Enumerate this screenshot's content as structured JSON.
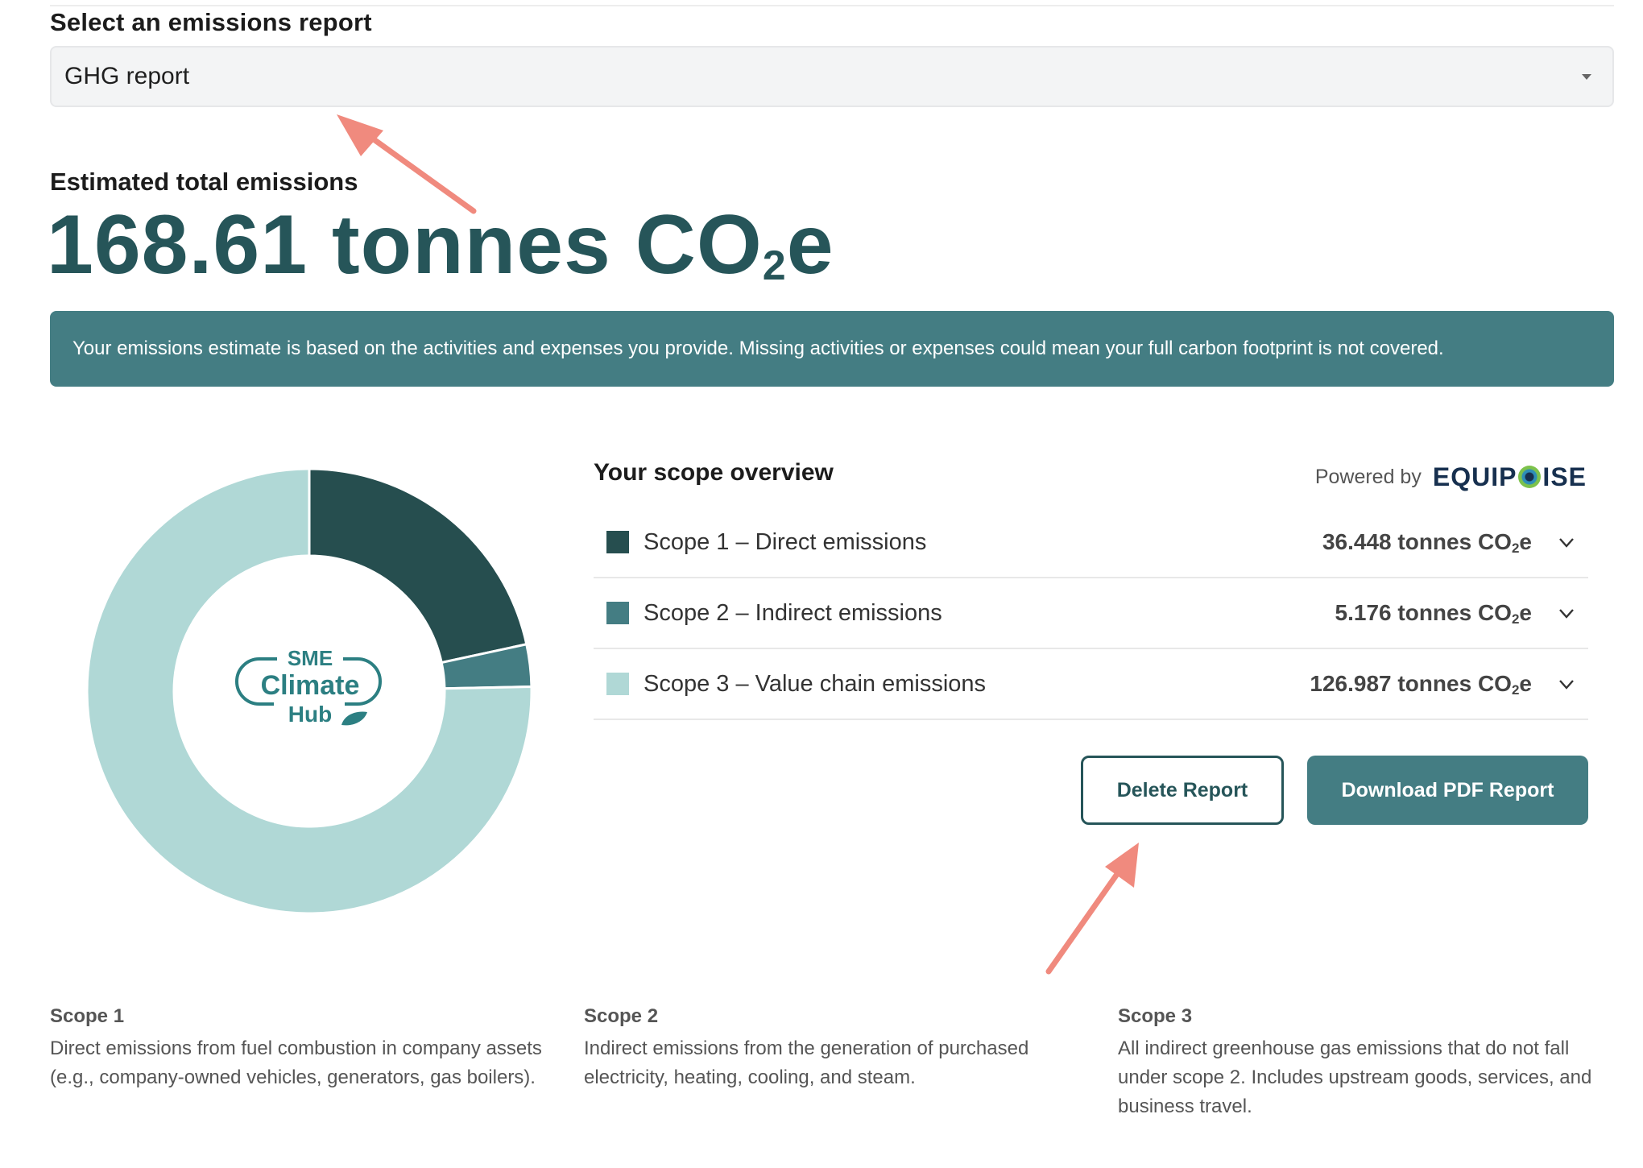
{
  "report_selector": {
    "label": "Select an emissions report",
    "selected_value": "GHG report"
  },
  "totals": {
    "label": "Estimated total emissions",
    "value": "168.61 tonnes CO",
    "unit_subscript": "2",
    "unit_suffix": "e"
  },
  "banner": {
    "text": "Your emissions estimate is based on the activities and expenses you provide. Missing activities or expenses could mean your full carbon footprint is not covered."
  },
  "overview": {
    "title": "Your scope overview",
    "powered_by": "Powered by",
    "brand_left": "EQUIP",
    "brand_right": "ISE",
    "scopes": [
      {
        "name": "Scope 1 – Direct emissions",
        "amount": "36.448 tonnes CO",
        "sub": "2",
        "suffix": "e",
        "color": "#264e4f"
      },
      {
        "name": "Scope 2 – Indirect emissions",
        "amount": "5.176 tonnes CO",
        "sub": "2",
        "suffix": "e",
        "color": "#447d83"
      },
      {
        "name": "Scope 3 – Value chain emissions",
        "amount": "126.987 tonnes CO",
        "sub": "2",
        "suffix": "e",
        "color": "#b0d8d6"
      }
    ]
  },
  "actions": {
    "delete_label": "Delete Report",
    "download_label": "Download PDF Report"
  },
  "logo": {
    "line1": "SME",
    "line2": "Climate",
    "line3": "Hub"
  },
  "chart_data": {
    "type": "pie",
    "categories": [
      "Scope 1 – Direct emissions",
      "Scope 2 – Indirect emissions",
      "Scope 3 – Value chain emissions"
    ],
    "values": [
      36.448,
      5.176,
      126.987
    ],
    "colors": [
      "#264e4f",
      "#447d83",
      "#b0d8d6"
    ],
    "donut": true
  },
  "descriptions": [
    {
      "title": "Scope 1",
      "body": "Direct emissions from fuel combustion in company assets (e.g., company-owned vehicles, generators, gas boilers)."
    },
    {
      "title": "Scope 2",
      "body": "Indirect emissions from the generation of purchased electricity, heating, cooling, and steam."
    },
    {
      "title": "Scope 3",
      "body": "All indirect greenhouse gas emissions that do not fall under scope 2. Includes upstream goods, services, and business travel."
    }
  ]
}
